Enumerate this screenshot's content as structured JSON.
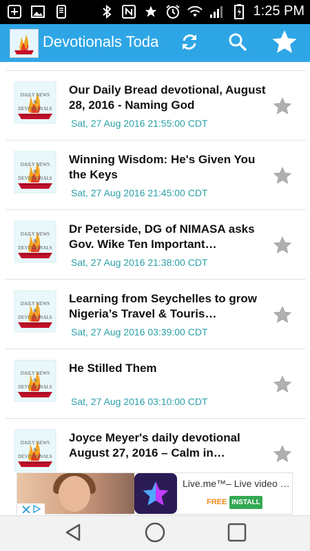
{
  "status_bar": {
    "time": "1:25 PM",
    "left_icons": [
      "plus-icon",
      "image-icon",
      "storage-icon"
    ],
    "right_icons": [
      "bluetooth-icon",
      "nfc-icon",
      "star-icon",
      "alarm-icon",
      "wifi-icon",
      "signal-icon",
      "battery-icon"
    ]
  },
  "app_bar": {
    "title": "Devotionals Today",
    "actions": [
      "refresh-icon",
      "search-icon",
      "favorites-star-icon"
    ]
  },
  "items": [
    {
      "title": "Our Daily Bread devotional, August 28, 2016 - Naming God",
      "date": "Sat, 27 Aug 2016 21:55:00 CDT",
      "starred": false
    },
    {
      "title": "Winning Wisdom: He's Given You the Keys",
      "date": "Sat, 27 Aug 2016 21:45:00 CDT",
      "starred": false
    },
    {
      "title": "Dr Peterside, DG of NIMASA asks Gov. Wike Ten Important…",
      "date": "Sat, 27 Aug 2016 21:38:00 CDT",
      "starred": false
    },
    {
      "title": "Learning from Seychelles to grow Nigeria’s Travel & Touris…",
      "date": "Sat, 27 Aug 2016 03:39:00 CDT",
      "starred": false
    },
    {
      "title": "He Stilled Them",
      "date": "Sat, 27 Aug 2016 03:10:00 CDT",
      "starred": false
    },
    {
      "title": "Joyce Meyer's daily devotional August 27, 2016 – Calm in…",
      "date": "",
      "starred": false
    }
  ],
  "ad": {
    "title": "Live.me™– Live video s…",
    "free_label": "FREE",
    "install_label": "INSTALL"
  },
  "colors": {
    "app_bar": "#2ea6e6",
    "date_text": "#2aa0a8",
    "star": "#b0b0b0"
  }
}
